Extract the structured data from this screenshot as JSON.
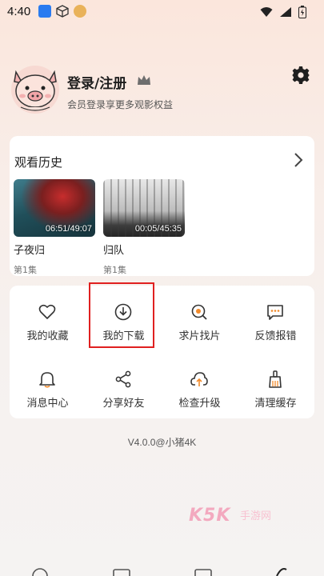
{
  "status_bar": {
    "time": "4:40"
  },
  "profile": {
    "title": "登录/注册",
    "subtitle": "会员登录享更多观影权益"
  },
  "history": {
    "title": "观看历史",
    "items": [
      {
        "title": "子夜归",
        "episode": "第1集",
        "progress": "06:51/49:07"
      },
      {
        "title": "归队",
        "episode": "第1集",
        "progress": "00:05/45:35"
      }
    ]
  },
  "menu": {
    "items": [
      {
        "label": "我的收藏",
        "icon": "heart-icon"
      },
      {
        "label": "我的下载",
        "icon": "download-icon"
      },
      {
        "label": "求片找片",
        "icon": "search-film-icon"
      },
      {
        "label": "反馈报错",
        "icon": "feedback-icon"
      },
      {
        "label": "消息中心",
        "icon": "bell-icon"
      },
      {
        "label": "分享好友",
        "icon": "share-icon"
      },
      {
        "label": "检查升级",
        "icon": "upgrade-icon"
      },
      {
        "label": "清理缓存",
        "icon": "broom-icon"
      }
    ]
  },
  "version": "V4.0.0@小猪4K",
  "watermark": {
    "brand": "K5K",
    "tag": "手游网"
  },
  "colors": {
    "highlight": "#e02020",
    "accent_bg": "#fbe6dc"
  }
}
